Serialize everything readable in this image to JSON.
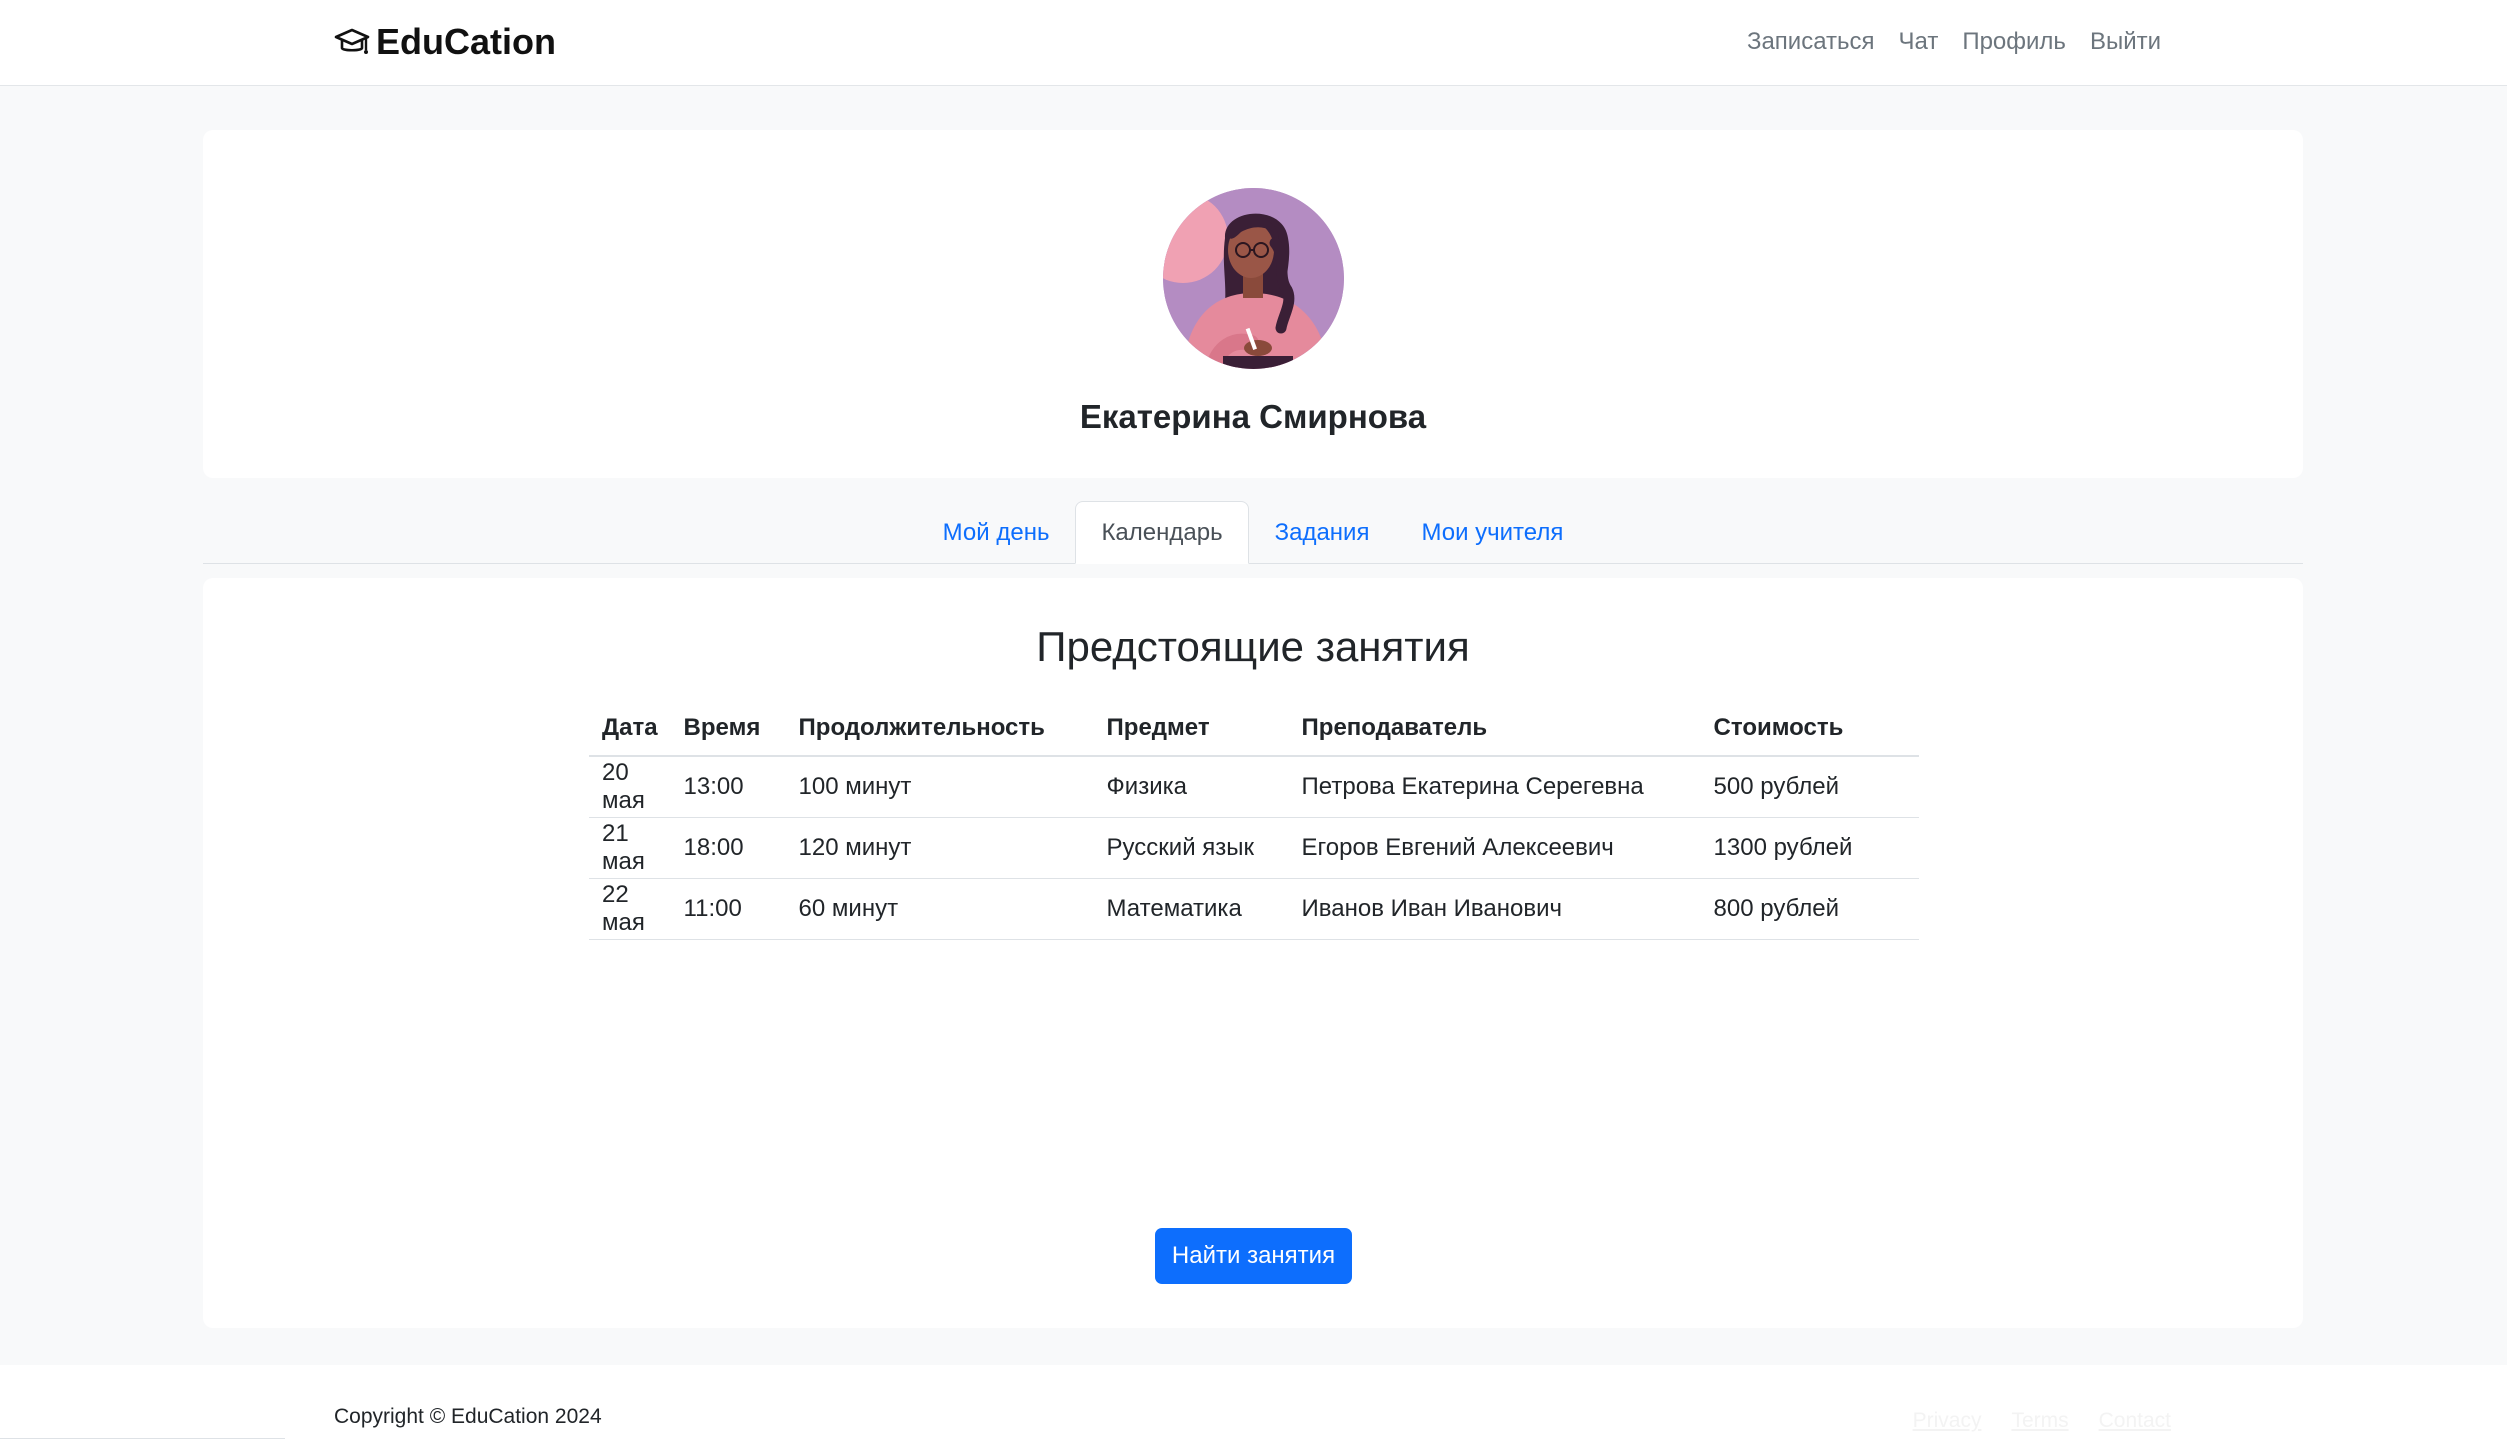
{
  "brand": {
    "name": "EduCation",
    "icon": "graduation-cap-icon"
  },
  "nav": {
    "signup": "Записаться",
    "chat": "Чат",
    "profile": "Профиль",
    "logout": "Выйти"
  },
  "profile": {
    "name": "Екатерина Смирнова"
  },
  "tabs": [
    {
      "label": "Мой день",
      "active": false
    },
    {
      "label": "Календарь",
      "active": true
    },
    {
      "label": "Задания",
      "active": false
    },
    {
      "label": "Мои учителя",
      "active": false
    }
  ],
  "lessons": {
    "title": "Предстоящие занятия",
    "headers": [
      "Дата",
      "Время",
      "Продолжительность",
      "Предмет",
      "Преподаватель",
      "Стоимость"
    ],
    "rows": [
      [
        "20 мая",
        "13:00",
        "100 минут",
        "Физика",
        "Петрова Екатерина Серегевна",
        "500 рублей"
      ],
      [
        "21 мая",
        "18:00",
        "120 минут",
        "Русский язык",
        "Егоров Евгений Алексеевич",
        "1300 рублей"
      ],
      [
        "22 мая",
        "11:00",
        "60 минут",
        "Математика",
        "Иванов Иван Иванович",
        "800 рублей"
      ]
    ],
    "find_button": "Найти занятия"
  },
  "footer": {
    "copyright": "Copyright © EduCation 2024",
    "links": [
      "Privacy",
      "Terms",
      "Contact"
    ]
  },
  "colors": {
    "primary": "#0d6efd",
    "nav_text": "#6c757d",
    "background": "#f8f9fa"
  }
}
